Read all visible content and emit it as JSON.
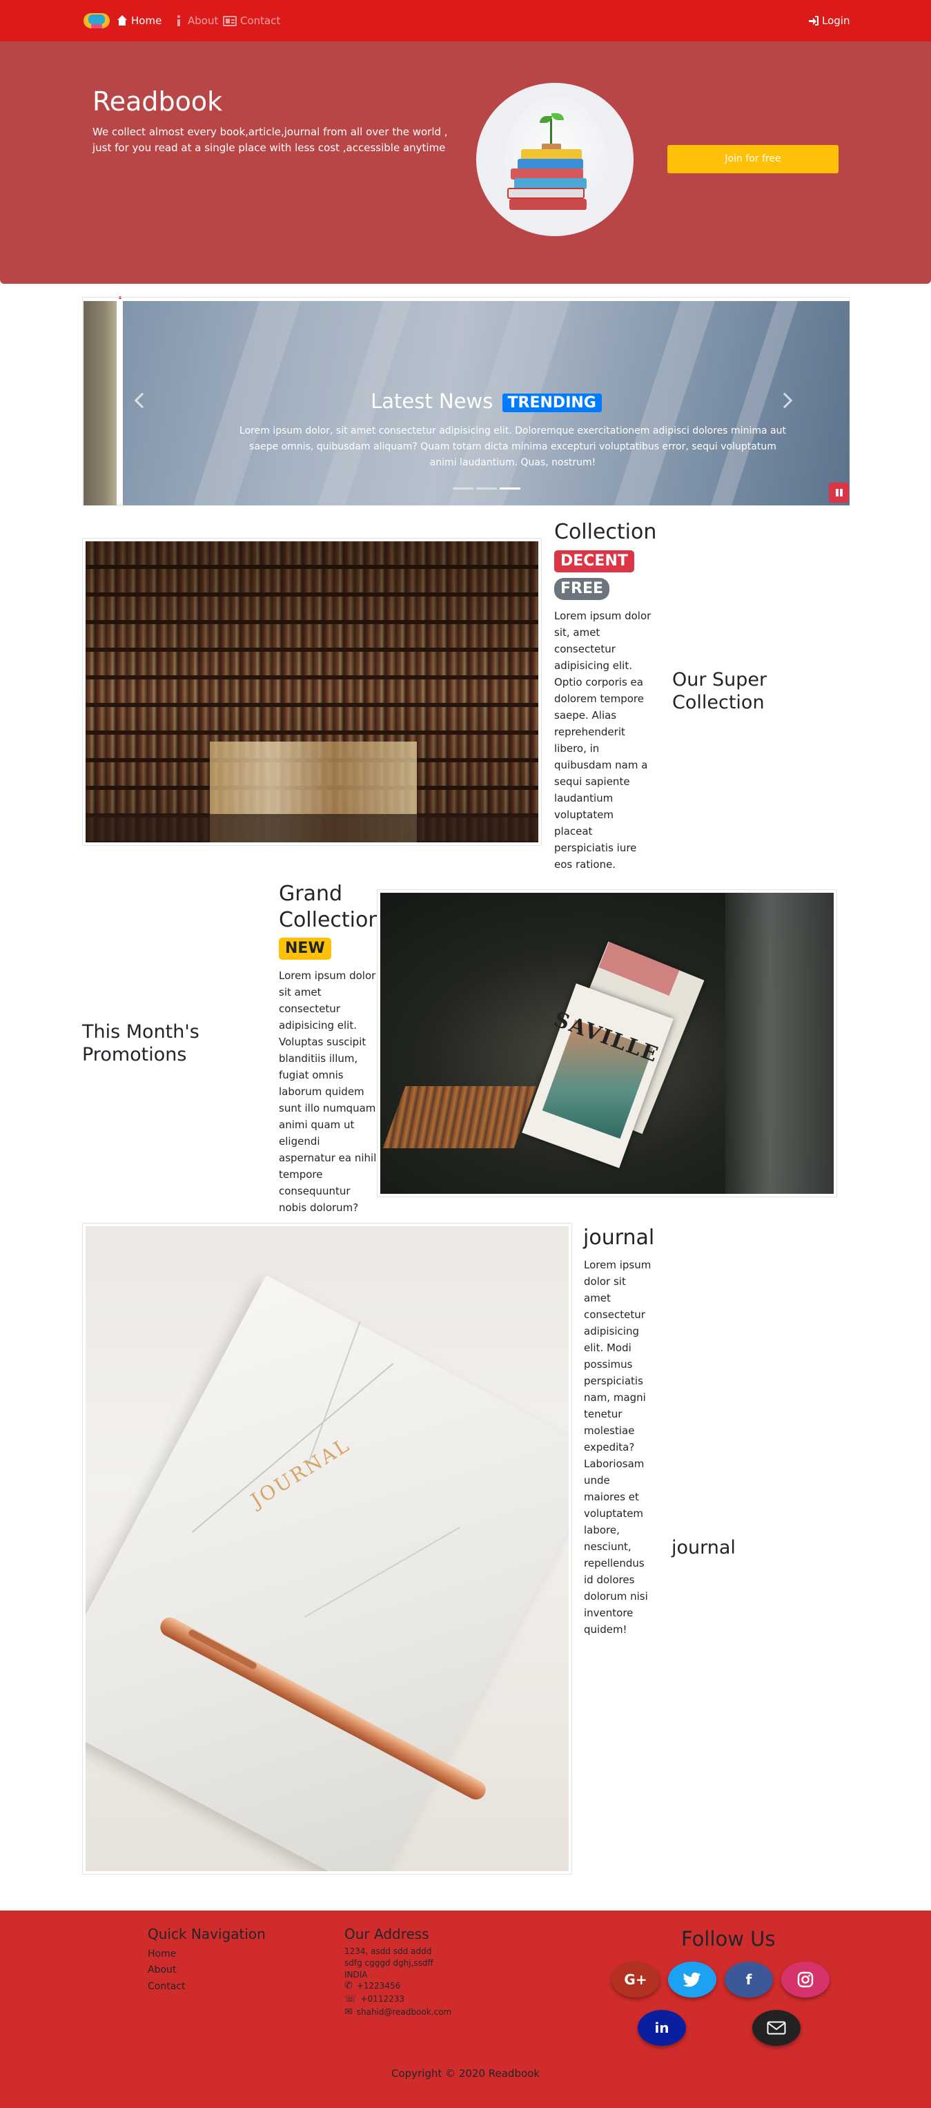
{
  "navbar": {
    "brand_icon": "book-logo-icon",
    "items": [
      {
        "label": "Home",
        "icon": "home-icon",
        "active": true
      },
      {
        "label": "About",
        "icon": "info-icon",
        "active": false
      },
      {
        "label": "Contact",
        "icon": "id-card-icon",
        "active": false
      }
    ],
    "login_label": "Login",
    "bar_color": "#dc1a1a"
  },
  "hero": {
    "title": "Readbook",
    "text": "We collect almost every book,article,journal from all over the world , just for you read at a single place with less cost ,accessible anytime",
    "cta_label": "Join for free",
    "background": "#b94646",
    "cta_color": "#ffc107"
  },
  "carousel": {
    "title": "Latest News",
    "badge": "TRENDING",
    "text": "Lorem ipsum dolor, sit amet consectetur adipisicing elit. Doloremque exercitationem adipisci dolores minima aut saepe omnis, quibusdam aliquam? Quam totam dicta minima excepturi voluptatibus error, sequi voluptatum animi laudantium. Quas, nostrum!",
    "indicators": 3,
    "active_indicator": 2
  },
  "collection": {
    "title": "Collection",
    "badges": [
      "DECENT",
      "FREE"
    ],
    "text": "Lorem ipsum dolor sit, amet consectetur adipisicing elit. Optio corporis ea dolorem tempore saepe. Alias reprehenderit libero, in quibusdam nam a sequi sapiente laudantium voluptatem placeat perspiciatis iure eos ratione.",
    "side_title": "Our Super Collection"
  },
  "grand": {
    "title": "Grand Collection",
    "badge": "NEW",
    "text": "Lorem ipsum dolor sit amet consectetur adipisicing elit. Voluptas suscipit blanditiis illum, fugiat omnis laborum quidem sunt illo numquam animi quam ut eligendi aspernatur ea nihil tempore consequuntur nobis dolorum?",
    "side_title": "This Month's Promotions",
    "magazine_word": "SAVILLE"
  },
  "journal": {
    "title": "journal",
    "text": "Lorem ipsum dolor sit amet consectetur adipisicing elit. Modi possimus perspiciatis nam, magni tenetur molestiae expedita? Laboriosam unde maiores et voluptatem labore, nesciunt, repellendus id dolores dolorum nisi inventore quidem!",
    "side_title": "journal",
    "book_word": "JOURNAL"
  },
  "footer": {
    "nav_title": "Quick Navigation",
    "nav_links": [
      "Home",
      "About",
      "Contact"
    ],
    "address_title": "Our Address",
    "address_lines": [
      "1234, asdd sdd addd",
      "sdfg cgggd dghj,ssdff",
      "INDIA"
    ],
    "phone1": "+1223456",
    "phone2": "+0112233",
    "email": "shahid@readbook.com",
    "follow_title": "Follow Us",
    "social": [
      {
        "name": "google-plus",
        "color": "#b23121",
        "label": "G+"
      },
      {
        "name": "twitter",
        "color": "#1da1f2",
        "label": ""
      },
      {
        "name": "facebook",
        "color": "#3b5998",
        "label": "f"
      },
      {
        "name": "instagram",
        "color": "#d6336c",
        "label": ""
      },
      {
        "name": "linkedin",
        "color": "#0a1f9e",
        "label": "in"
      },
      {
        "name": "email",
        "color": "#222222",
        "label": ""
      }
    ],
    "copyright": "Copyright © 2020 Readbook",
    "background": "#d12c2c"
  }
}
